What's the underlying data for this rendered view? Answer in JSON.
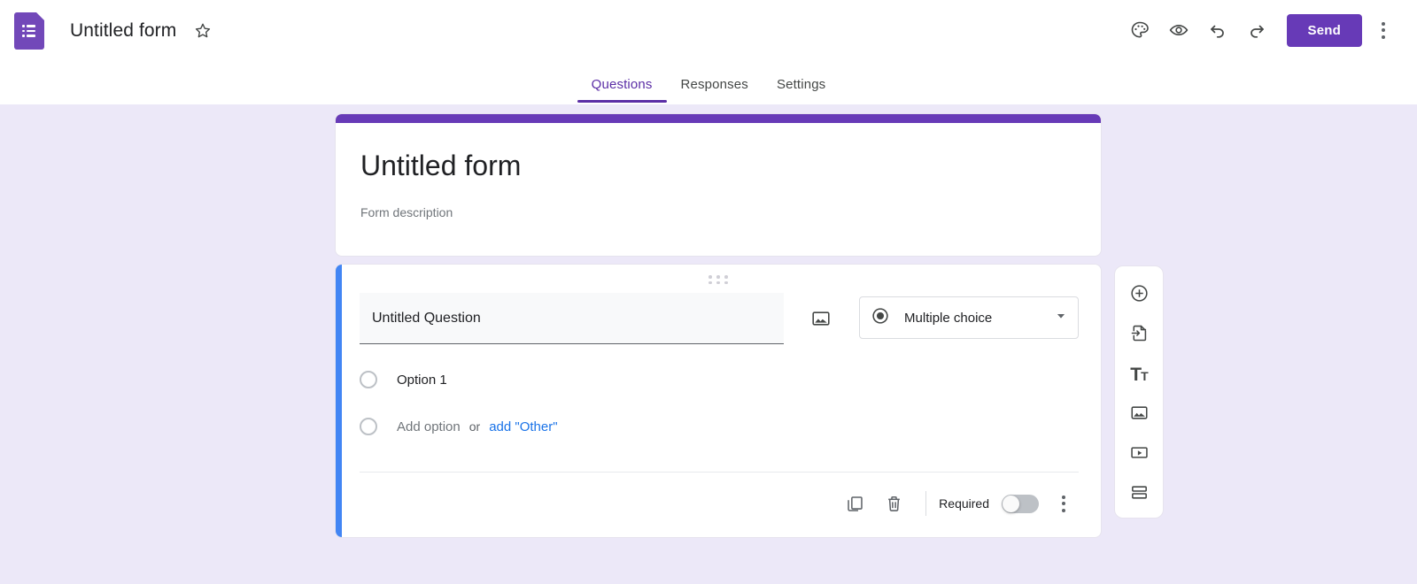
{
  "header": {
    "logo_icon": "google-forms-logo-icon",
    "form_title": "Untitled form",
    "star_icon": "star-outline-icon",
    "actions": [
      {
        "icon": "palette-icon",
        "name": "customize-theme-button"
      },
      {
        "icon": "eye-icon",
        "name": "preview-button"
      },
      {
        "icon": "undo-icon",
        "name": "undo-button"
      },
      {
        "icon": "redo-icon",
        "name": "redo-button"
      }
    ],
    "send_label": "Send",
    "more_icon": "more-vert-icon"
  },
  "tabs": [
    {
      "label": "Questions",
      "active": true
    },
    {
      "label": "Responses",
      "active": false
    },
    {
      "label": "Settings",
      "active": false
    }
  ],
  "title_card": {
    "heading": "Untitled form",
    "description": "Form description",
    "accent_color": "#673ab7"
  },
  "question_card": {
    "accent_color": "#4285f4",
    "drag_handle_icon": "drag-dots-icon",
    "question_text": "Untitled Question",
    "image_icon": "add-image-icon",
    "type": {
      "icon": "radio-filled-icon",
      "label": "Multiple choice",
      "caret_icon": "chevron-down-icon"
    },
    "options": [
      {
        "label": "Option 1",
        "muted": false
      }
    ],
    "add_option": {
      "label": "Add option",
      "or": "or",
      "other_link": "add \"Other\""
    },
    "footer": {
      "duplicate_icon": "duplicate-icon",
      "delete_icon": "trash-icon",
      "required_label": "Required",
      "required_on": false,
      "more_icon": "more-vert-icon"
    }
  },
  "side_toolbar": [
    {
      "icon": "add-question-icon",
      "name": "add-question-button"
    },
    {
      "icon": "import-questions-icon",
      "name": "import-questions-button"
    },
    {
      "icon": "add-title-icon",
      "name": "add-title-button",
      "glyph": "Tt"
    },
    {
      "icon": "add-image-icon",
      "name": "add-image-button"
    },
    {
      "icon": "add-video-icon",
      "name": "add-video-button"
    },
    {
      "icon": "add-section-icon",
      "name": "add-section-button"
    }
  ],
  "colors": {
    "background": "#ece8f8",
    "purple": "#673ab7",
    "blue_accent": "#4285f4",
    "link_blue": "#1a73e8"
  }
}
